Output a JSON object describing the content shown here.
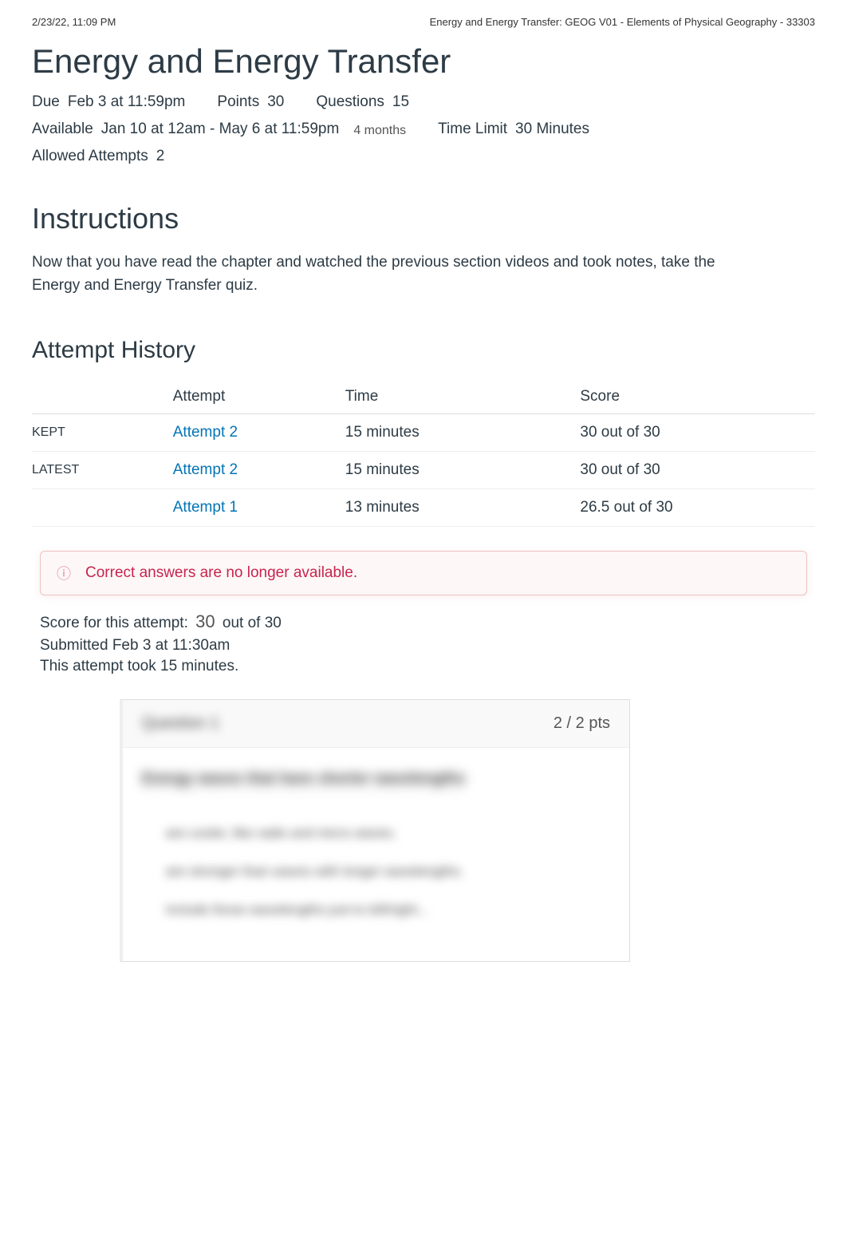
{
  "print_header": {
    "left": "2/23/22, 11:09 PM",
    "right": "Energy and Energy Transfer: GEOG V01 - Elements of Physical Geography - 33303"
  },
  "quiz": {
    "title": "Energy and Energy Transfer",
    "due_label": "Due",
    "due_value": "Feb 3 at 11:59pm",
    "points_label": "Points",
    "points_value": "30",
    "questions_label": "Questions",
    "questions_value": "15",
    "available_label": "Available",
    "available_value": "Jan 10 at 12am - May 6 at 11:59pm",
    "available_duration": "4 months",
    "time_limit_label": "Time Limit",
    "time_limit_value": "30 Minutes",
    "allowed_attempts_label": "Allowed Attempts",
    "allowed_attempts_value": "2"
  },
  "instructions": {
    "heading": "Instructions",
    "body": "Now that you have read the chapter and watched the previous section videos and took notes, take the Energy and Energy Transfer quiz."
  },
  "attempt_history": {
    "heading": "Attempt History",
    "columns": {
      "tag": "",
      "attempt": "Attempt",
      "time": "Time",
      "score": "Score"
    },
    "rows": [
      {
        "tag": "KEPT",
        "attempt": "Attempt 2",
        "time": "15 minutes",
        "score": "30 out of 30"
      },
      {
        "tag": "LATEST",
        "attempt": "Attempt 2",
        "time": "15 minutes",
        "score": "30 out of 30"
      },
      {
        "tag": "",
        "attempt": "Attempt 1",
        "time": "13 minutes",
        "score": "26.5 out of 30"
      }
    ]
  },
  "alert": {
    "text": "Correct answers are no longer available."
  },
  "attempt_summary": {
    "score_prefix": "Score for this attempt:",
    "score_value": "30",
    "score_suffix": "out of 30",
    "submitted": "Submitted Feb 3 at 11:30am",
    "duration": "This attempt took 15 minutes."
  },
  "question": {
    "label": "Question 1",
    "pts": "2 / 2 pts",
    "prompt": "Energy waves that have shorter wavelengths",
    "options": [
      "are cooler, like radio and micro waves.",
      "are stronger than waves with longer wavelengths.",
      "include those wavelengths just to left/right..."
    ]
  }
}
